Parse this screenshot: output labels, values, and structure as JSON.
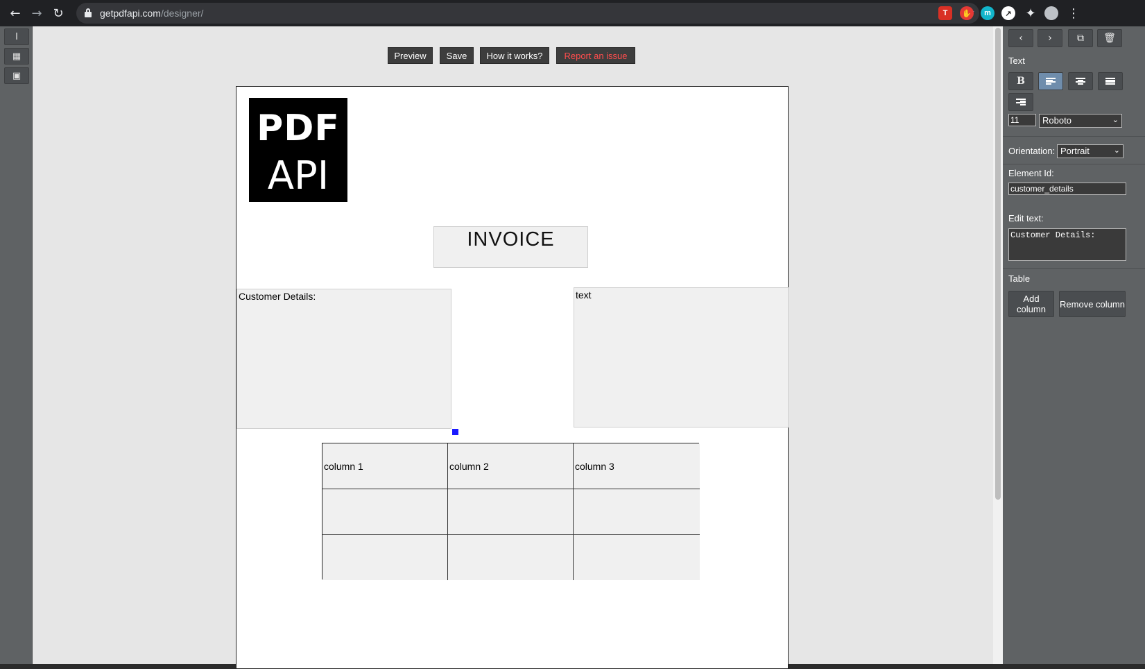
{
  "browser": {
    "url_host": "getpdfapi.com",
    "url_path": "/designer/",
    "extensions": [
      {
        "name": "pdf-ext-icon",
        "color": "#d93025",
        "glyph": "T"
      },
      {
        "name": "red-ext-icon",
        "color": "#e53935",
        "glyph": "✋"
      },
      {
        "name": "m-ext-icon",
        "color": "#12b5cb",
        "glyph": "m"
      },
      {
        "name": "white-ext-icon",
        "color": "#ffffff",
        "glyph": "↗"
      }
    ]
  },
  "toolbar": {
    "preview": "Preview",
    "save": "Save",
    "how_it_works": "How it works?",
    "report_issue": "Report an issue"
  },
  "page": {
    "logo_line1": "PDF",
    "logo_line2": "API",
    "title": "INVOICE",
    "customer_details": "Customer Details:",
    "text_box": "text",
    "table": {
      "headers": [
        "column 1",
        "column 2",
        "column 3"
      ],
      "rows": [
        [
          "",
          "",
          ""
        ],
        [
          "",
          "",
          ""
        ]
      ]
    }
  },
  "panel": {
    "text_label": "Text",
    "bold": "B",
    "font_size": "11",
    "font_family": "Roboto",
    "orientation_label": "Orientation:",
    "orientation_value": "Portrait",
    "element_id_label": "Element Id:",
    "element_id_value": "customer_details",
    "edit_text_label": "Edit text:",
    "edit_text_value": "Customer Details:",
    "table_label": "Table",
    "add_column": "Add column",
    "remove_column": "Remove column"
  },
  "colors": {
    "accent_active": "#6f8dac",
    "danger": "#ff4d4d",
    "handle": "#1a1aff"
  }
}
